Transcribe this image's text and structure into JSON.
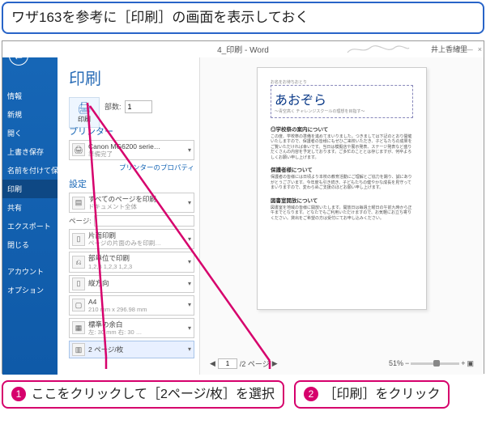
{
  "top_callout": "ワザ163を参考に［印刷］の画面を表示しておく",
  "titlebar": {
    "text": "4_印刷 - Word",
    "user": "井上香緒里",
    "help": "?",
    "min": "—",
    "close": "×"
  },
  "sidebar": {
    "items": [
      "情報",
      "新規",
      "開く",
      "上書き保存",
      "名前を付けて保存",
      "印刷",
      "共有",
      "エクスポート",
      "閉じる"
    ],
    "footer": [
      "アカウント",
      "オプション"
    ],
    "active_index": 5
  },
  "backstage": {
    "heading": "印刷",
    "print_btn": "印刷",
    "copies_label": "部数:",
    "copies_value": "1",
    "printer_label": "プリンター",
    "printer_name": "Canon MG6200 serie…",
    "printer_status": "準備完了",
    "printer_props": "プリンターのプロパティ",
    "settings_label": "設定",
    "dd_allpages_t": "すべてのページを印刷",
    "dd_allpages_s": "ドキュメント全体",
    "pages_label": "ページ:",
    "dd_oneside_t": "片面印刷",
    "dd_oneside_s": "ページの片面のみを印刷…",
    "dd_collate_t": "部単位で印刷",
    "dd_collate_s": "1,2,3   1,2,3   1,2,3",
    "dd_orient": "縦方向",
    "dd_paper_t": "A4",
    "dd_paper_s": "210 mm x 296.98 mm",
    "dd_margin_t": "標準の余白",
    "dd_margin_s": "左: 30 mm  右: 30 …",
    "dd_sheet": "2 ページ/枚"
  },
  "preview": {
    "small_top": "お名をお待ちおとり",
    "title": "あおぞら",
    "tagline": "～青空高く     チャレンジスクールの理想を目指す～",
    "sec1": "◎学校祭の案内について",
    "body1": "この度、学校祭の準備を進めてまいりました。つきましては下記のとおり開催いたしますので、保護者の皆様にもぜひご来校いただき、子どもたちの成果をご覧いただければ幸いです。当日は模擬店や展示発表、ステージ発表など盛りだくさんの内容を予定しております。ご多忙のこととは存じますが、何卒よろしくお願い申し上げます。",
    "sec2": "保護者様について",
    "body2": "保護者の皆様には日頃より本校の教育活動にご理解とご協力を賜り、誠にありがとうございます。今年度も引き続き、子どもたちの健やかな成長を見守ってまいりますので、変わらぬご支援のほどお願い申し上げます。",
    "sec3": "図書室開放について",
    "body3": "図書室を地域の皆様に開放いたします。開放日は毎週土曜日の午前九時から正午までとなります。どなたでもご利用いただけますので、お気軽にお立ち寄りください。貸出をご希望の方は受付にてお申し込みください。",
    "pager_total": "/2 ページ",
    "pager_cur": "1",
    "zoom_pct": "51%"
  },
  "callouts": {
    "c1": "ここをクリックして［2ページ/枚］を選択",
    "c2": "［印刷］をクリック"
  }
}
